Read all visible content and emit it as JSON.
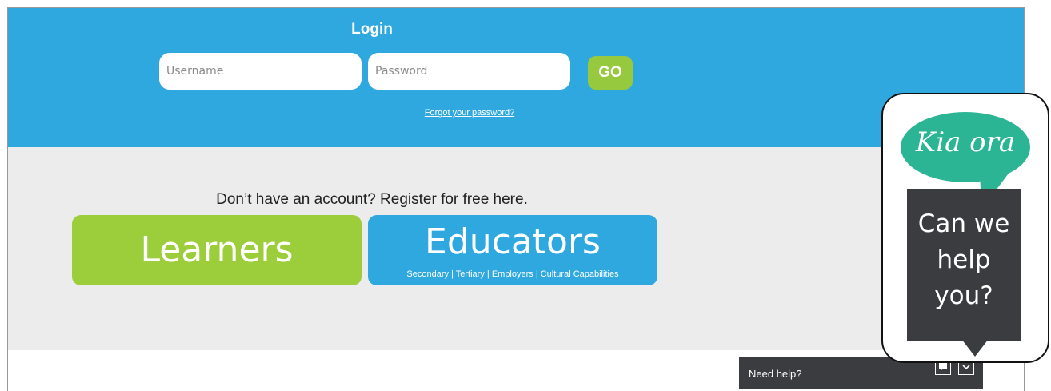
{
  "login": {
    "title": "Login",
    "username_placeholder": "Username",
    "password_placeholder": "Password",
    "go_label": "GO",
    "forgot_link": "Forgot your password?"
  },
  "register": {
    "heading": "Don’t have an account? Register for free here.",
    "learners_label": "Learners",
    "educators_label": "Educators",
    "educators_sub": "Secondary | Tertiary | Employers | Cultural Capabilities"
  },
  "help_widget": {
    "greeting": "Kia ora",
    "message": "Can we\nhelp\nyou?",
    "bar_label": "Need help?",
    "icons": [
      "chat-icon",
      "chevron-down-icon"
    ]
  },
  "colors": {
    "login_blue": "#2fa8e0",
    "learners_green": "#9bce3a",
    "go_green": "#96c93d",
    "register_grey": "#ececec",
    "widget_teal": "#2cb594",
    "widget_dark": "#3a3c40"
  }
}
